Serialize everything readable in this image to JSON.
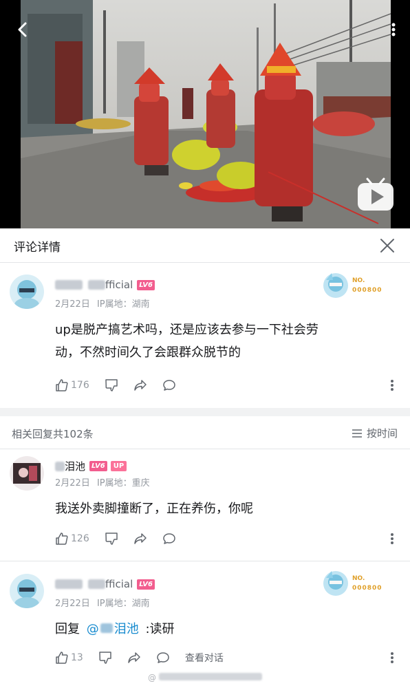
{
  "header": {
    "title": "评论详情"
  },
  "main_comment": {
    "username_visible": "fficial",
    "level": "LV6",
    "date": "2月22日",
    "ip_location": "IP属地：湖南",
    "text_line1": "up是脱产搞艺术吗，还是应该去参与一下社会劳",
    "text_line2": "动，不然时间久了会跟群众脱节的",
    "likes": "176",
    "badge_text_top": "NO.",
    "badge_text_bottom": "000800"
  },
  "replies_bar": {
    "count_label": "相关回复共102条",
    "sort_label": "按时间"
  },
  "replies": [
    {
      "username_visible": "泪池",
      "level": "LV6",
      "up_tag": "UP",
      "date": "2月22日",
      "ip_location": "IP属地：重庆",
      "text": "我送外卖脚撞断了，正在养伤，你呢",
      "likes": "126"
    },
    {
      "username_visible": "fficial",
      "level": "LV6",
      "date": "2月22日",
      "ip_location": "IP属地：湖南",
      "reply_prefix": "回复",
      "mention": "@",
      "mention_name": "泪池",
      "text": ":读研",
      "likes": "13",
      "view_conversation": "查看对话",
      "badge_text_top": "NO.",
      "badge_text_bottom": "000800"
    }
  ],
  "watermark": "@",
  "colors": {
    "level": "#f25d8e",
    "up_tag": "#fb7299",
    "link": "#178bcf",
    "muted": "#9499a0"
  }
}
